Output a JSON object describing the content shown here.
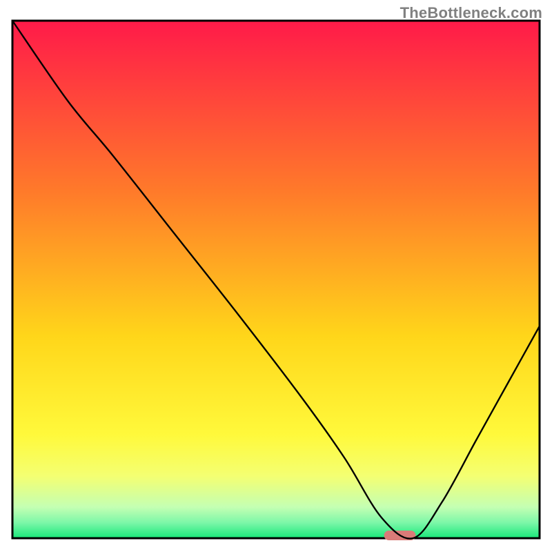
{
  "watermark": {
    "text": "TheBottleneck.com"
  },
  "chart_data": {
    "type": "line",
    "title": "",
    "xlabel": "",
    "ylabel": "",
    "xlim": [
      0,
      100
    ],
    "ylim": [
      0,
      100
    ],
    "x": [
      0.0,
      10.5,
      19.0,
      31.0,
      43.0,
      55.0,
      63.0,
      70.0,
      76.0,
      81.5,
      88.0,
      94.0,
      100.0
    ],
    "values": [
      100.0,
      84.5,
      74.0,
      58.5,
      43.0,
      27.0,
      15.5,
      4.0,
      0.0,
      7.0,
      19.0,
      30.0,
      41.0
    ],
    "minimum_marker": {
      "x_center": 73.5,
      "width": 6,
      "color": "#da7b78"
    },
    "gradient_y_pct": [
      0.0,
      33.0,
      61.0,
      80.0,
      88.0,
      94.0,
      97.0,
      100.0
    ]
  }
}
